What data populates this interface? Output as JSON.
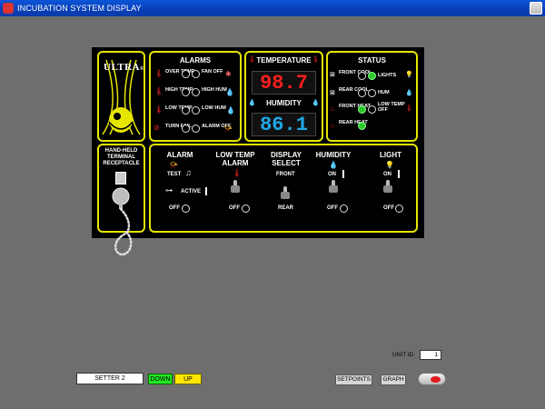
{
  "window": {
    "title": "INCUBATION SYSTEM DISPLAY"
  },
  "logo": {
    "text": "ULTRA",
    "mark": "®"
  },
  "alarms": {
    "title": "ALARMS",
    "items": [
      {
        "label": "OVER TEMP",
        "icon": "thermometer-icon"
      },
      {
        "label": "FAN OFF",
        "icon": "fan-icon"
      },
      {
        "label": "HIGH TEMP",
        "icon": "thermometer-icon"
      },
      {
        "label": "HIGH HUM",
        "icon": "water-drops-icon"
      },
      {
        "label": "LOW TEMP",
        "icon": "thermometer-icon"
      },
      {
        "label": "LOW HUM",
        "icon": "water-drop-icon"
      },
      {
        "label": "TURN FAIL",
        "icon": "no-turn-icon"
      },
      {
        "label": "ALARM OFF",
        "icon": "horn-off-icon"
      }
    ]
  },
  "readouts": {
    "temperature_label": "TEMPERATURE",
    "temperature_value": "98.7",
    "humidity_label": "HUMIDITY",
    "humidity_value": "86.1",
    "temp_color": "#ff1e1e",
    "hum_color": "#20a8e8"
  },
  "status": {
    "title": "STATUS",
    "items": [
      {
        "label": "FRONT COOL",
        "on": false
      },
      {
        "label": "LIGHTS",
        "on": true
      },
      {
        "label": "REAR COOL",
        "on": false
      },
      {
        "label": "HUM",
        "on": false
      },
      {
        "label": "FRONT HEAT",
        "on": true
      },
      {
        "label": "LOW TEMP OFF",
        "on": false
      },
      {
        "label": "REAR HEAT",
        "on": true
      }
    ],
    "on_color": "#2cc82c"
  },
  "handheld": {
    "title": "HAND-HELD TERMINAL RECEPTACLE"
  },
  "controls": {
    "alarm": {
      "title": "ALARM",
      "test": "TEST",
      "active": "ACTIVE",
      "off": "OFF"
    },
    "low_temp_alarm": {
      "title": "LOW TEMP ALARM",
      "off": "OFF"
    },
    "display_select": {
      "title": "DISPLAY SELECT",
      "front": "FRONT",
      "rear": "REAR"
    },
    "humidity": {
      "title": "HUMIDITY",
      "on": "ON",
      "off": "OFF"
    },
    "light": {
      "title": "LIGHT",
      "on": "ON",
      "off": "OFF"
    }
  },
  "bottom": {
    "setter_value": "SETTER 2",
    "down_label": "DOWN",
    "up_label": "UP",
    "setpoints_label": "SETPOINTS",
    "graph_label": "GRAPH",
    "unit_id_label": "UNIT ID",
    "unit_id_value": "1"
  }
}
